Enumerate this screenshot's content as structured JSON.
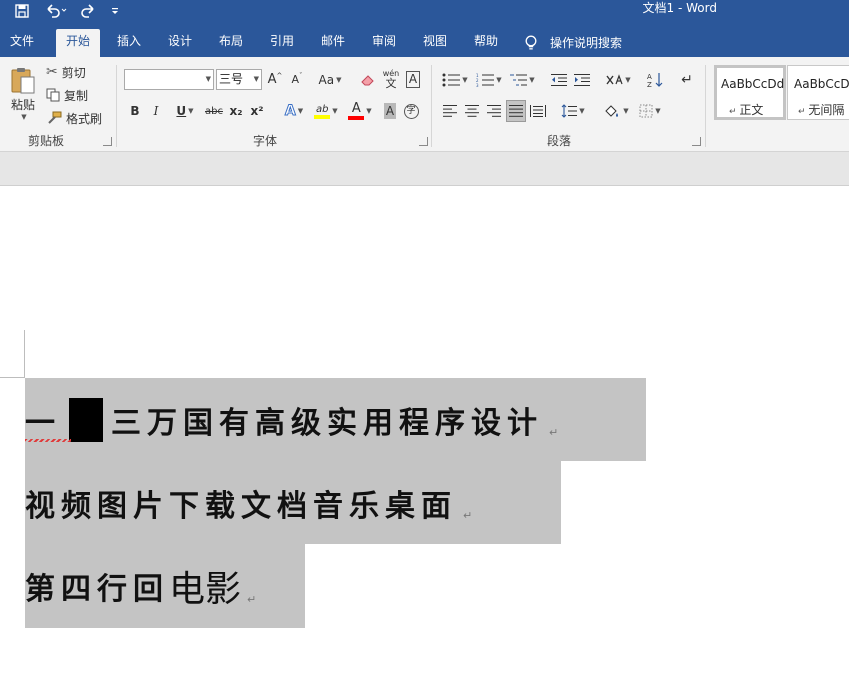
{
  "titlebar": {
    "title": "文档1  -  Word",
    "icons": [
      "save-icon",
      "undo-icon",
      "redo-icon",
      "customize-qat-icon"
    ]
  },
  "tabs": [
    {
      "label": "文件"
    },
    {
      "label": "开始",
      "active": true
    },
    {
      "label": "插入"
    },
    {
      "label": "设计"
    },
    {
      "label": "布局"
    },
    {
      "label": "引用"
    },
    {
      "label": "邮件"
    },
    {
      "label": "审阅"
    },
    {
      "label": "视图"
    },
    {
      "label": "帮助"
    }
  ],
  "tell_me": "操作说明搜索",
  "clipboard": {
    "paste": "粘贴",
    "cut": "剪切",
    "copy": "复制",
    "format_painter": "格式刷",
    "group_label": "剪贴板"
  },
  "font": {
    "font_name": "",
    "font_size": "三号",
    "change_case": "Aa",
    "group_label": "字体",
    "bold": "B",
    "italic": "I",
    "underline": "U",
    "strikethrough": "abc",
    "subscript": "x₂",
    "superscript": "x²",
    "grow": "A",
    "shrink": "A",
    "text_effect": "A",
    "highlight": "ab",
    "font_color": "A",
    "char_shading": "A",
    "enclose": "字",
    "phonetic": "wén",
    "char_border": "A"
  },
  "paragraph": {
    "group_label": "段落"
  },
  "styles": [
    {
      "sample": "AaBbCcDd",
      "name": "正文"
    },
    {
      "sample": "AaBbCcDd",
      "name": "无间隔"
    }
  ],
  "document": {
    "lines": [
      {
        "before": "一",
        "after": "三万国有高级实用程序设计"
      },
      {
        "text": "视频图片下载文档音乐桌面"
      },
      {
        "text": "第四行回",
        "text_large": "电影"
      }
    ],
    "para_mark": "↵"
  },
  "colors": {
    "word_blue": "#2b579a",
    "selection_gray": "#c4c4c4",
    "highlight_yellow": "#ffff00",
    "font_color_red": "#ff0000"
  }
}
